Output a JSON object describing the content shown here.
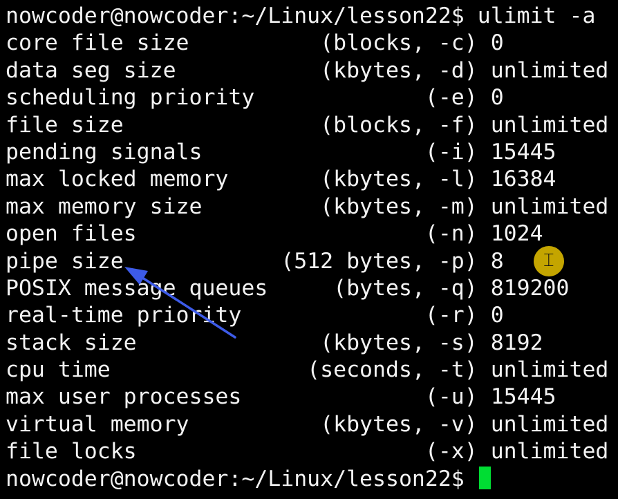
{
  "terminal": {
    "prompt": "nowcoder@nowcoder:~/Linux/lesson22$",
    "command": " ulimit -a",
    "limits": [
      "core file size          (blocks, -c) 0",
      "data seg size           (kbytes, -d) unlimited",
      "scheduling priority             (-e) 0",
      "file size               (blocks, -f) unlimited",
      "pending signals                 (-i) 15445",
      "max locked memory       (kbytes, -l) 16384",
      "max memory size         (kbytes, -m) unlimited",
      "open files                      (-n) 1024",
      "pipe size            (512 bytes, -p) 8",
      "POSIX message queues     (bytes, -q) 819200",
      "real-time priority              (-r) 0",
      "stack size              (kbytes, -s) 8192",
      "cpu time               (seconds, -t) unlimited",
      "max user processes              (-u) 15445",
      "virtual memory          (kbytes, -v) unlimited",
      "file locks                      (-x) unlimited"
    ],
    "final_prompt": "nowcoder@nowcoder:~/Linux/lesson22$ "
  },
  "colors": {
    "background": "#000000",
    "text": "#f2f2f2",
    "cursor": "#00dd33",
    "pointer_highlight": "#d9b700",
    "arrow": "#3d5be8"
  }
}
